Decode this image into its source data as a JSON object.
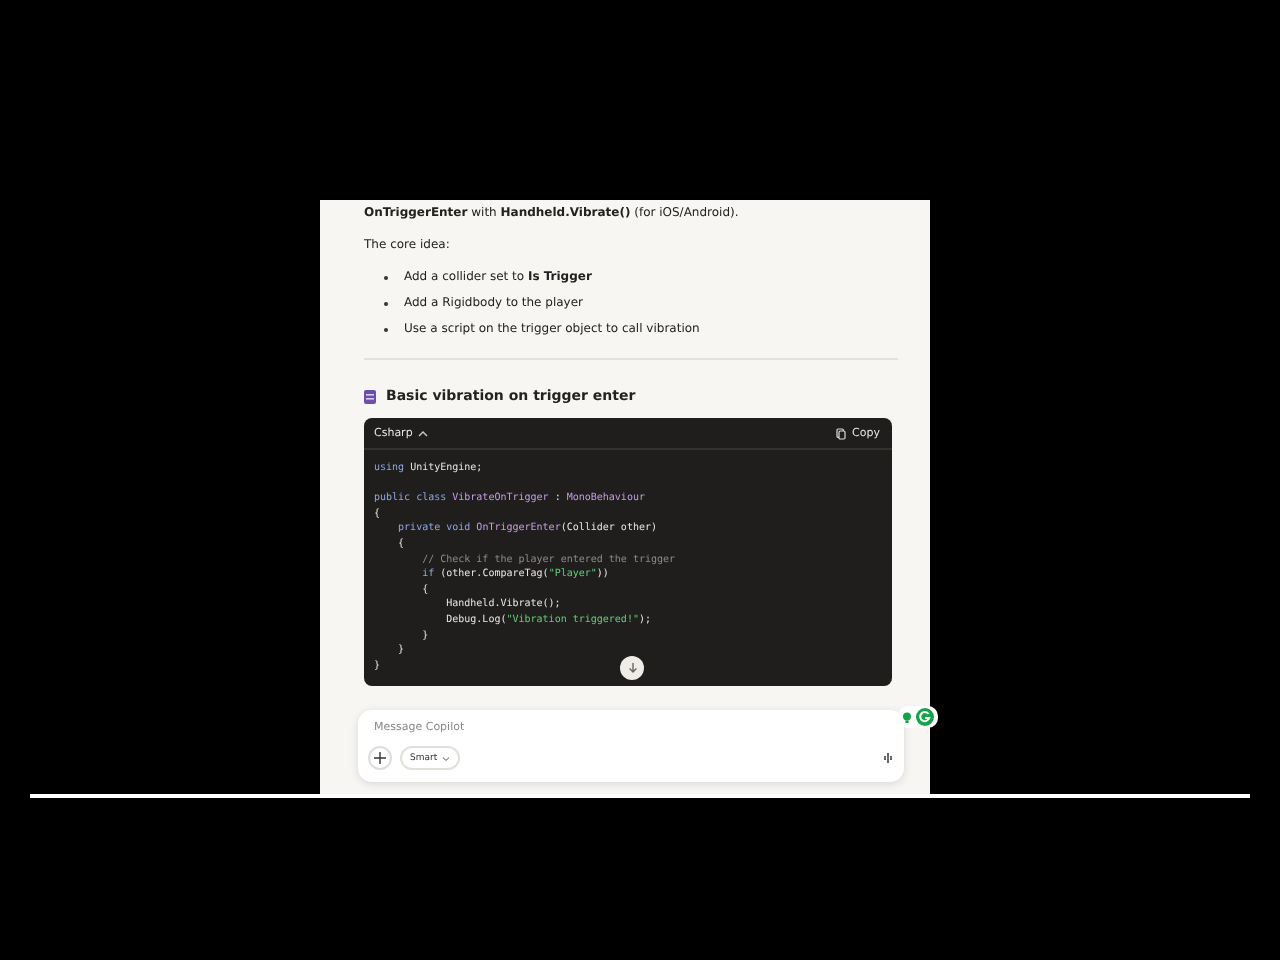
{
  "intro": "**OnTriggerEnter** with **Handheld.Vibrate()** (for iOS/Android).",
  "core_idea": "The core idea:",
  "bullets": [
    "Add a collider set to **Is Trigger**",
    "Add a Rigidbody to the player",
    "Use a script on the trigger object to call vibration"
  ],
  "section_heading": "Basic vibration on trigger enter",
  "code_block": {
    "language": "Csharp",
    "expanded": true,
    "copy_label": "Copy",
    "lines": [
      {
        "blank_line_before": false,
        "segments": [
          {
            "kind": "keyword",
            "text": "using"
          },
          {
            "kind": "plain",
            "text": " UnityEngine;"
          }
        ]
      },
      {
        "blank_line_before": true,
        "segments": [
          {
            "kind": "keyword",
            "text": "public class"
          },
          {
            "kind": "type",
            "text": " VibrateOnTrigger"
          },
          {
            "kind": "plain",
            "text": " : "
          },
          {
            "kind": "type",
            "text": "MonoBehaviour"
          }
        ]
      },
      {
        "blank_line_before": false,
        "segments": [
          {
            "kind": "plain",
            "text": "{"
          }
        ]
      },
      {
        "blank_line_before": false,
        "segments": [
          {
            "kind": "keyword",
            "text": "    private void"
          },
          {
            "kind": "type",
            "text": " OnTriggerEnter"
          },
          {
            "kind": "plain",
            "text": "(Collider other)"
          }
        ]
      },
      {
        "blank_line_before": false,
        "segments": [
          {
            "kind": "plain",
            "text": "    {"
          }
        ]
      },
      {
        "blank_line_before": false,
        "segments": [
          {
            "kind": "comment",
            "text": "        // Check if the player entered the trigger"
          }
        ]
      },
      {
        "blank_line_before": false,
        "segments": [
          {
            "kind": "keyword",
            "text": "        if"
          },
          {
            "kind": "plain",
            "text": " (other.CompareTag("
          },
          {
            "kind": "string",
            "text": "\"Player\""
          },
          {
            "kind": "plain",
            "text": "))"
          }
        ]
      },
      {
        "blank_line_before": false,
        "segments": [
          {
            "kind": "plain",
            "text": "        {"
          }
        ]
      },
      {
        "blank_line_before": false,
        "segments": [
          {
            "kind": "plain",
            "text": "            Handheld.Vibrate();"
          }
        ]
      },
      {
        "blank_line_before": false,
        "segments": [
          {
            "kind": "plain",
            "text": "            Debug.Log("
          },
          {
            "kind": "string",
            "text": "\"Vibration triggered!\""
          },
          {
            "kind": "plain",
            "text": ");"
          }
        ]
      },
      {
        "blank_line_before": false,
        "segments": [
          {
            "kind": "plain",
            "text": "        }"
          }
        ]
      },
      {
        "blank_line_before": false,
        "segments": [
          {
            "kind": "plain",
            "text": "    }"
          }
        ]
      },
      {
        "blank_line_before": false,
        "segments": [
          {
            "kind": "plain",
            "text": "}"
          }
        ]
      }
    ]
  },
  "composer": {
    "placeholder": "Message Copilot",
    "mode": "Smart"
  }
}
